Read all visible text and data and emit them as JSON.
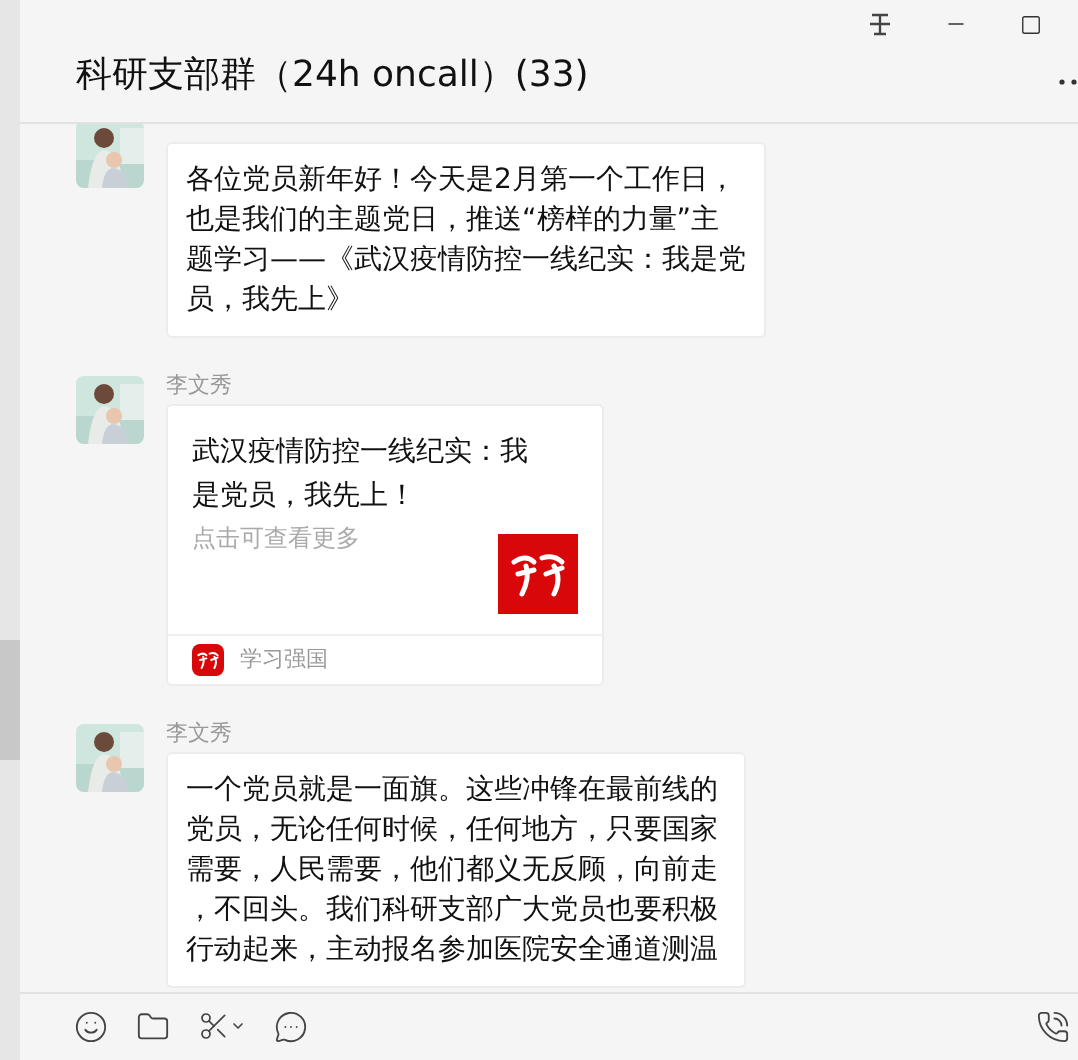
{
  "window": {
    "title": "科研支部群（24h oncall）(33)"
  },
  "messages": [
    {
      "kind": "text",
      "text": "各位党员新年好！今天是2月第一个工作日，也是我们的主题党日，推送“榜样的力量”主题学习——《武汉疫情防控一线纪实：我是党员，我先上》"
    },
    {
      "kind": "card",
      "sender": "李文秀",
      "title": "武汉疫情防控一线纪实：我是党员，我先上！",
      "hint": "点击可查看更多",
      "source": "学习强国"
    },
    {
      "kind": "text",
      "sender": "李文秀",
      "text": "一个党员就是一面旗。这些冲锋在最前线的党员，无论任何时候，任何地方，只要国家需要，人民需要，他们都义无反顾，向前走，不回头。我们科研支部广大党员也要积极行动起来，主动报名参加医院安全通道测温"
    }
  ]
}
